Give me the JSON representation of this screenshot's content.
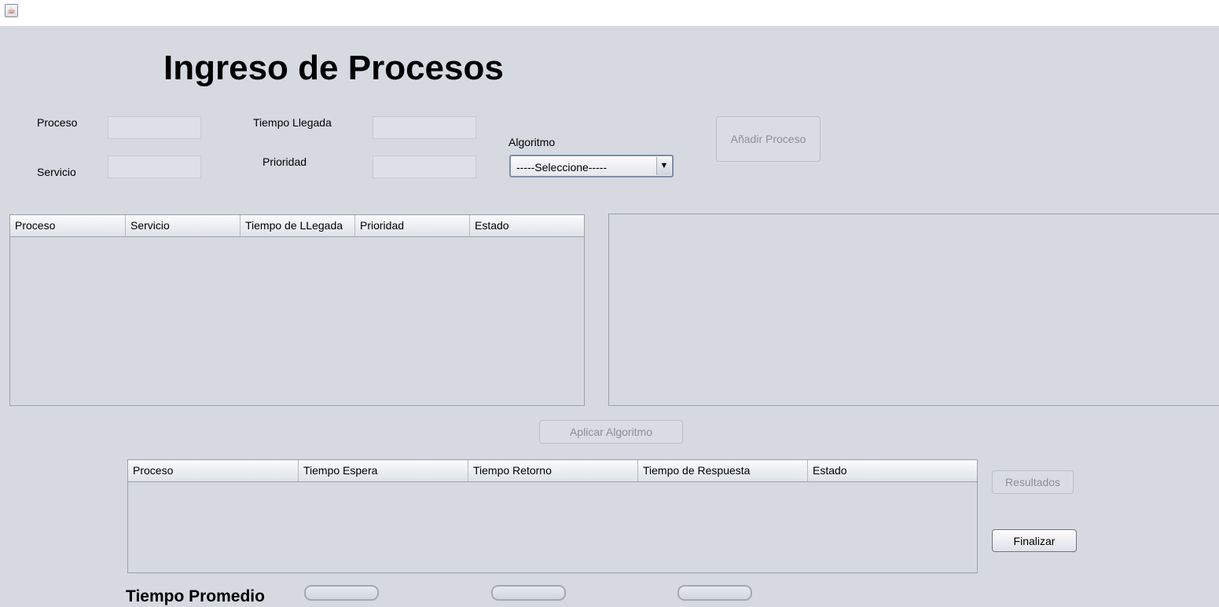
{
  "window": {
    "icon": "java-icon"
  },
  "form": {
    "title": "Ingreso de Procesos",
    "proceso_label": "Proceso",
    "servicio_label": "Servicio",
    "tiempo_llegada_label": "Tiempo Llegada",
    "prioridad_label": "Prioridad",
    "algoritmo_label": "Algoritmo",
    "algoritmo_selected": "-----Seleccione-----",
    "proceso_value": "",
    "servicio_value": "",
    "tiempo_llegada_value": "",
    "prioridad_value": "",
    "add_button": "Añadir Proceso"
  },
  "processes_table": {
    "columns": [
      "Proceso",
      "Servicio",
      "Tiempo de LLegada",
      "Prioridad",
      "Estado"
    ],
    "rows": []
  },
  "apply_button": "Aplicar Algoritmo",
  "results_table": {
    "columns": [
      "Proceso",
      "Tiempo Espera",
      "Tiempo Retorno",
      "Tiempo de Respuesta",
      "Estado"
    ],
    "rows": []
  },
  "results_button": "Resultados",
  "finish_button": "Finalizar",
  "average": {
    "title": "Tiempo Promedio",
    "espera": "",
    "retorno": "",
    "respuesta": ""
  }
}
